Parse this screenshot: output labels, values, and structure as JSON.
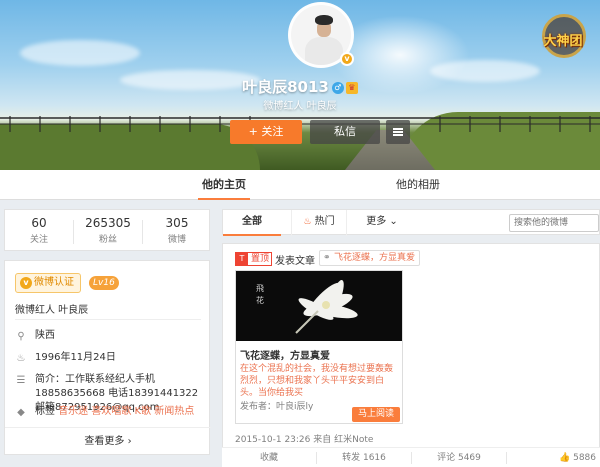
{
  "cover": {
    "game_logo_text": "大神团"
  },
  "profile_header": {
    "name": "叶良辰8013",
    "verify_mark": "v",
    "gender_mark": "♂",
    "intro": "微博红人 叶良辰"
  },
  "header_buttons": {
    "follow": "+ 关注",
    "message": "私信"
  },
  "tabs": [
    {
      "label": "他的主页",
      "active": true
    },
    {
      "label": "他的相册",
      "active": false
    }
  ],
  "stats": [
    {
      "value": "60",
      "label": "关注"
    },
    {
      "value": "265305",
      "label": "粉丝"
    },
    {
      "value": "305",
      "label": "微博"
    }
  ],
  "profile": {
    "verified_label": "微博认证",
    "level": "Lv16",
    "title": "微博红人 叶良辰",
    "location": "陕西",
    "birthday": "1996年11月24日",
    "bio": "简介：工作联系经纪人手机18858635668 电话18391441322 邮箱872951926@qq.com",
    "tags_label": "标签",
    "tags": "音乐迷 喜欢唱歌 K歌 新闻热点",
    "view_more": "查看更多 ›"
  },
  "feed_tabs": {
    "all": "全部",
    "hot": "热门",
    "more": "更多 ⌄",
    "search_placeholder": "搜索他的微博"
  },
  "post": {
    "pin_label": "置顶",
    "pin_mark": "T",
    "heading": "发表文章",
    "link_text": "飞花逐蝶，方显真爱",
    "article_title": "飞花逐蝶，方显真爱",
    "article_desc": "在这个混乱的社会，我没有想过要轰轰烈烈，只想和我家丫头平平安安到白头。当你给我买",
    "publisher": "发布者：叶良i辰ly",
    "read_button": "马上阅读",
    "meta": "2015-10-1 23:26 来自 红米Note"
  },
  "actions": [
    {
      "label": "收藏"
    },
    {
      "label": "转发 1616"
    },
    {
      "label": "评论 5469"
    },
    {
      "label": "5886"
    }
  ],
  "colors": {
    "accent": "#fa7d3c",
    "follow": "#f77a2b",
    "link": "#eb7350"
  }
}
